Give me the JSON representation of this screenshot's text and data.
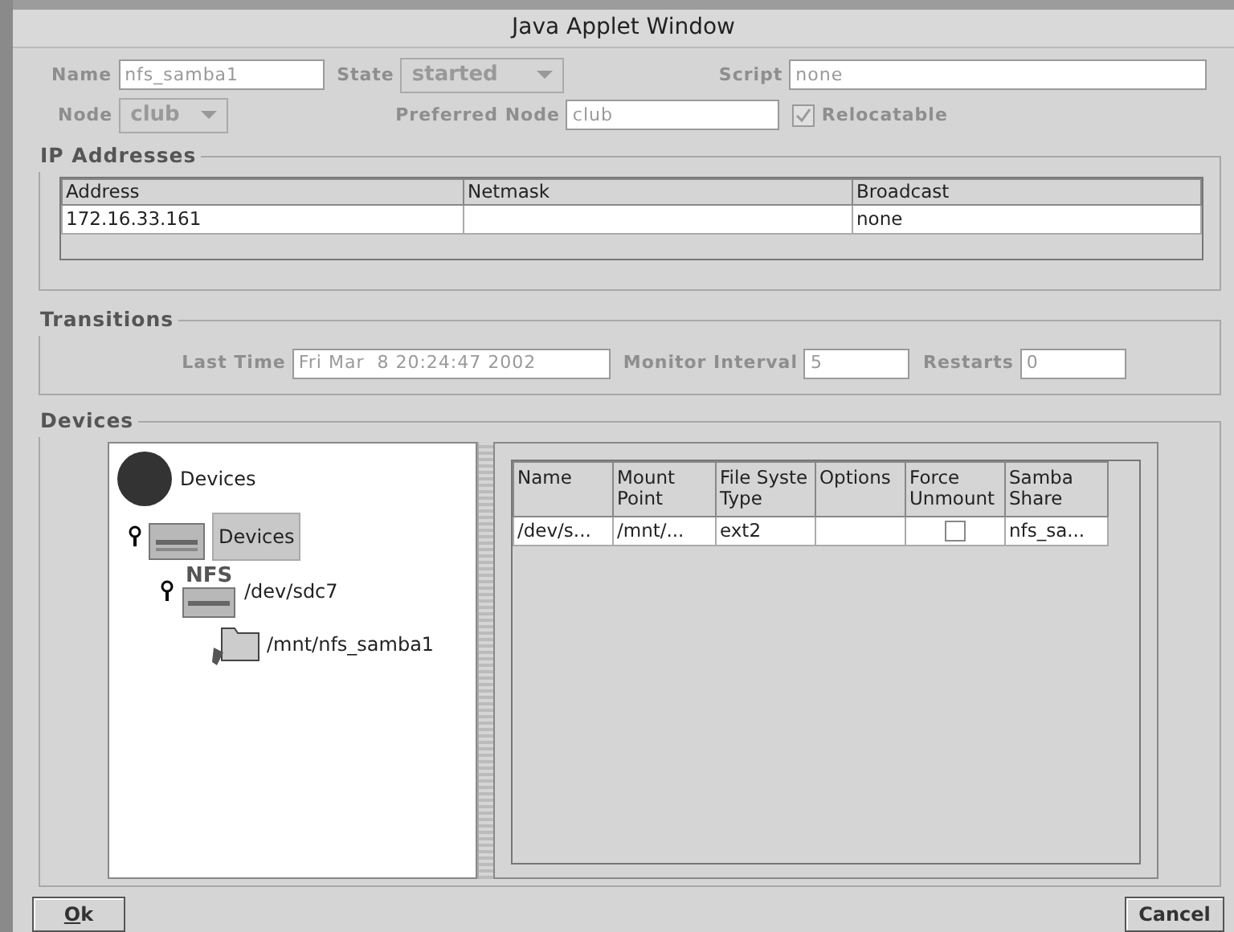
{
  "window": {
    "title": "Java Applet Window"
  },
  "general": {
    "name_label": "Name",
    "name_value": "nfs_samba1",
    "state_label": "State",
    "state_value": "started",
    "script_label": "Script",
    "script_value": "none",
    "node_label": "Node",
    "node_value": "club",
    "preferred_label": "Preferred Node",
    "preferred_value": "club",
    "relocatable": {
      "label": "Relocatable",
      "checked": true
    }
  },
  "ip_addresses": {
    "title": "IP Addresses",
    "columns": [
      "Address",
      "Netmask",
      "Broadcast"
    ],
    "rows": [
      [
        "172.16.33.161",
        "",
        "none"
      ]
    ]
  },
  "transitions": {
    "title": "Transitions",
    "last_time_label": "Last Time",
    "last_time_value": "Fri Mar  8 20:24:47 2002",
    "monitor_label": "Monitor Interval",
    "monitor_value": "5",
    "restarts_label": "Restarts",
    "restarts_value": "0"
  },
  "devices": {
    "title": "Devices",
    "tree": [
      {
        "label": "Devices",
        "kind": "root",
        "selected": false,
        "children": [
          {
            "label": "Devices",
            "kind": "device",
            "selected": true,
            "expanded": true,
            "children": [
              {
                "label": "/dev/sdc7",
                "kind": "nfs",
                "badge": "NFS",
                "selected": false,
                "expanded": true,
                "children": [
                  {
                    "label": "/mnt/nfs_samba1",
                    "kind": "folder",
                    "selected": false
                  }
                ]
              }
            ]
          }
        ]
      }
    ],
    "table": {
      "columns": [
        "Name",
        "Mount Point",
        "File Syste Type",
        "Options",
        "Force Unmount",
        "Samba Share"
      ],
      "rows": [
        {
          "cells": [
            "/dev/s...",
            "/mnt/...",
            "ext2",
            "",
            {
              "kind": "checkbox",
              "checked": false
            },
            "nfs_sa..."
          ]
        }
      ]
    }
  },
  "buttons": [
    {
      "label": "Ok",
      "mnemonic_underlined": true
    },
    {
      "label": "Cancel",
      "mnemonic_underlined": false
    }
  ]
}
